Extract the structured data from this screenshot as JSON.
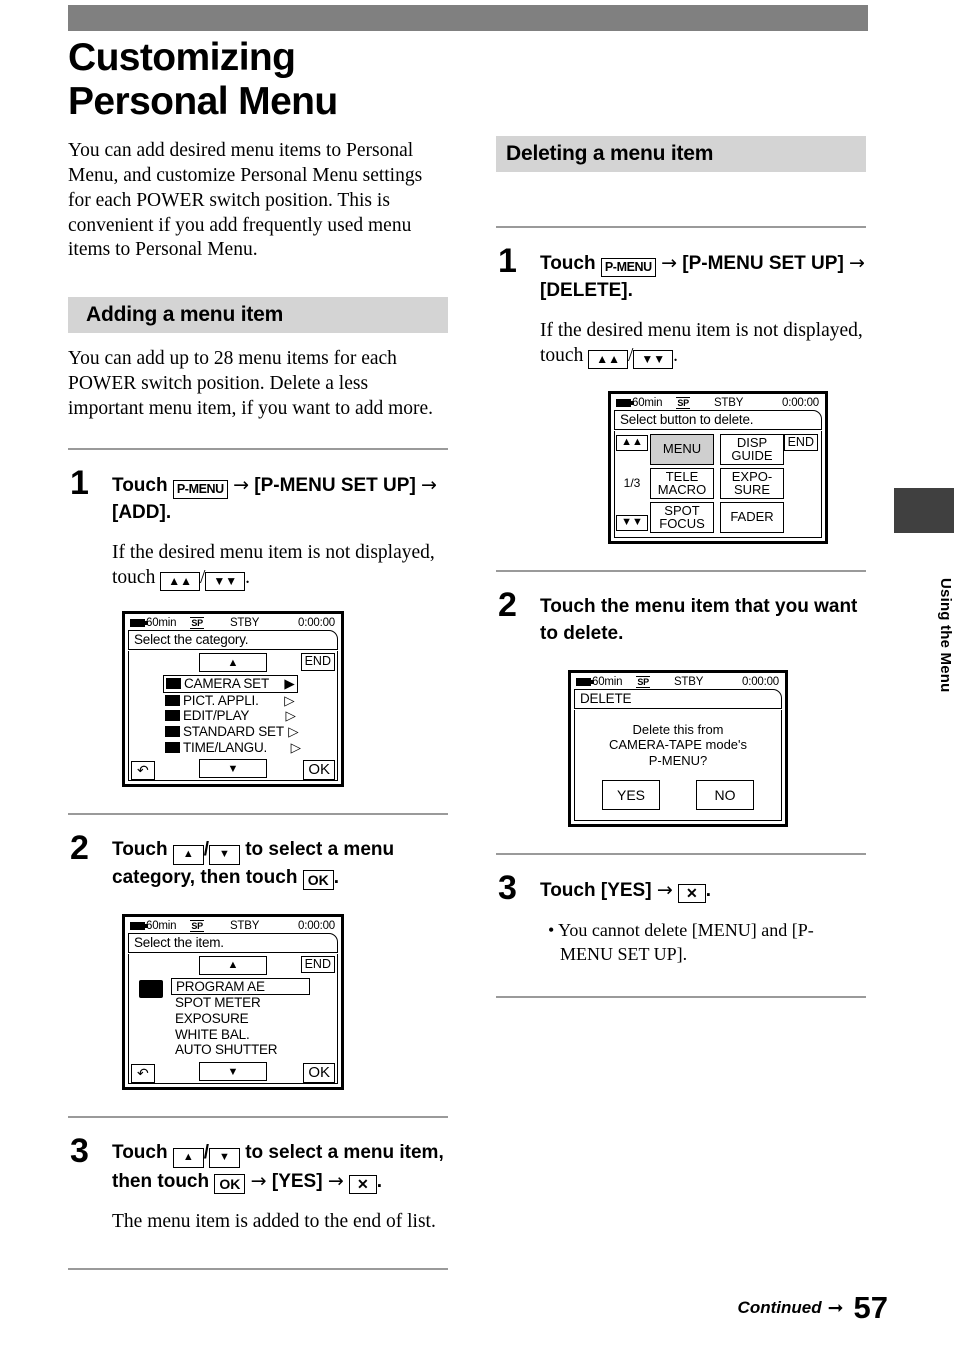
{
  "page": {
    "title": "Customizing Personal Menu",
    "intro": "You can add desired menu items to Personal Menu, and customize Personal Menu settings for each POWER switch position. This is convenient if you add frequently used menu items to Personal Menu.",
    "side_tab_label": "Using the Menu",
    "footer": {
      "continued": "Continued",
      "arrow": "➡",
      "page_number": "57"
    },
    "colors": {
      "band": "#808080",
      "section_head": "#d4d4d4",
      "tab": "#404040",
      "highlight": "#cfcfcf"
    }
  },
  "adding": {
    "heading": "Adding a menu item",
    "intro": "You can add up to 28 menu items for each POWER switch position. Delete a less important menu item, if you want to add more.",
    "steps": [
      {
        "number": "1",
        "text_parts": [
          "Touch",
          "P-MENU",
          "→",
          "[P-MENU SET UP]",
          "→",
          "[ADD]."
        ],
        "touch_label": "Touch",
        "key_pmenu": "P-MENU",
        "target1": "[P-MENU SET UP]",
        "target2": "[ADD].",
        "note_before": "If the desired menu item is not displayed, touch",
        "key_up": "»",
        "key_down": "»",
        "note_after": "."
      },
      {
        "number": "2",
        "touch_label": "Touch",
        "mid": "to select a menu category, then touch",
        "key_ok": "OK",
        "tail": "."
      },
      {
        "number": "3",
        "touch_label": "Touch",
        "mid": "to select a menu item, then touch",
        "key_ok": "OK",
        "arrow1": "→",
        "yes": "[YES]",
        "arrow2": "→",
        "key_x": "✕",
        "tail": ".",
        "note": "The menu item is added to the end of list."
      }
    ],
    "screen_category": {
      "status": {
        "battery_time": "60min",
        "tape_mode": "SP",
        "state": "STBY",
        "counter": "0:00:00"
      },
      "title": "Select the category.",
      "end_label": "END",
      "ok_label": "OK",
      "page_indicator": "",
      "items": [
        {
          "label": "CAMERA  SET",
          "marker": "▶",
          "selected": true
        },
        {
          "label": "PICT. APPLI.",
          "marker": "▷",
          "selected": false
        },
        {
          "label": "EDIT/PLAY",
          "marker": "▷",
          "selected": false
        },
        {
          "label": "STANDARD  SET",
          "marker": "▷",
          "selected": false
        },
        {
          "label": "TIME/LANGU.",
          "marker": "▷",
          "selected": false
        }
      ]
    },
    "screen_item": {
      "status": {
        "battery_time": "60min",
        "tape_mode": "SP",
        "state": "STBY",
        "counter": "0:00:00"
      },
      "title": "Select the item.",
      "end_label": "END",
      "ok_label": "OK",
      "items": [
        {
          "label": "PROGRAM  AE",
          "selected": true
        },
        {
          "label": "SPOT  METER",
          "selected": false
        },
        {
          "label": "EXPOSURE",
          "selected": false
        },
        {
          "label": "WHITE  BAL.",
          "selected": false
        },
        {
          "label": "AUTO SHUTTER",
          "selected": false
        }
      ]
    }
  },
  "deleting": {
    "heading": "Deleting a menu item",
    "steps": [
      {
        "number": "1",
        "touch_label": "Touch",
        "key_pmenu": "P-MENU",
        "target1": "[P-MENU SET UP]",
        "target2": "[DELETE].",
        "note_before": "If the desired menu item is not displayed, touch",
        "note_after": "."
      },
      {
        "number": "2",
        "text": "Touch the menu item that you want to delete."
      },
      {
        "number": "3",
        "touch_label": "Touch",
        "yes": "[YES]",
        "arrow": "→",
        "key_x": "✕",
        "tail": ".",
        "bullet": "• You cannot delete [MENU] and [P-MENU SET UP]."
      }
    ],
    "screen_buttons": {
      "status": {
        "battery_time": "60min",
        "tape_mode": "SP",
        "state": "STBY",
        "counter": "0:00:00"
      },
      "title": "Select button to delete.",
      "end_label": "END",
      "page_indicator": "1/3",
      "buttons": [
        {
          "label": "MENU",
          "highlighted": true
        },
        {
          "label": "DISP\nGUIDE",
          "highlighted": false
        },
        {
          "label": "TELE\nMACRO",
          "highlighted": false
        },
        {
          "label": "EXPO-\nSURE",
          "highlighted": false
        },
        {
          "label": "SPOT\nFOCUS",
          "highlighted": false
        },
        {
          "label": "FADER",
          "highlighted": false
        }
      ]
    },
    "screen_confirm": {
      "status": {
        "battery_time": "60min",
        "tape_mode": "SP",
        "state": "STBY",
        "counter": "0:00:00"
      },
      "title": "DELETE",
      "message_line1": "Delete this from",
      "message_line2": "CAMERA-TAPE mode's",
      "message_line3": "P-MENU?",
      "yes_label": "YES",
      "no_label": "NO"
    }
  }
}
